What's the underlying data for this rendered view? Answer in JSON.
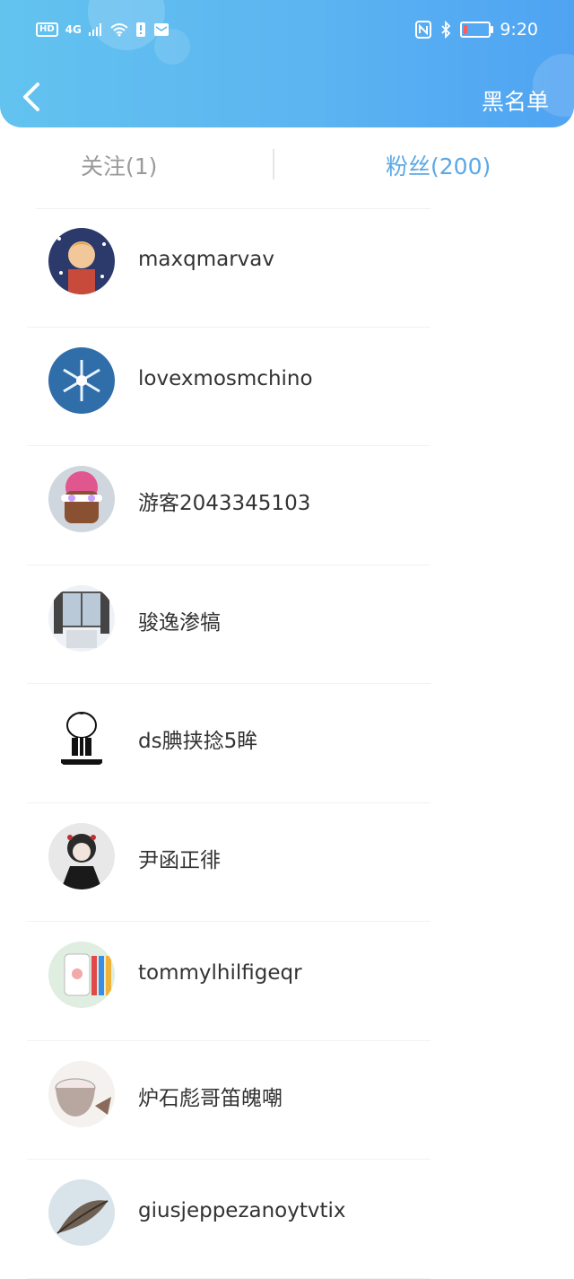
{
  "status_bar": {
    "left_badge": "HD",
    "network": "4G",
    "time": "9:20"
  },
  "header": {
    "back_icon": "chevron-left-icon",
    "action_label": "黑名单"
  },
  "tabs": {
    "following": "关注(1)",
    "fans": "粉丝(200)"
  },
  "fans": [
    {
      "name": "maxqmarvav",
      "avatar": "anime-character-stars"
    },
    {
      "name": "lovexmosmchino",
      "avatar": "snowflake"
    },
    {
      "name": "游客2043345103",
      "avatar": "pink-hair-sunglasses"
    },
    {
      "name": "骏逸渗犒",
      "avatar": "winter-window"
    },
    {
      "name": "ds腆挟捻5眸",
      "avatar": "meme-cartoon"
    },
    {
      "name": "尹函正徘",
      "avatar": "dark-anime-character"
    },
    {
      "name": "tommylhilfigeqr",
      "avatar": "phone-case"
    },
    {
      "name": "炉石彪哥笛魄嘲",
      "avatar": "cream-bowl"
    },
    {
      "name": "giusjeppezanoytvtix",
      "avatar": "leaf-art"
    }
  ],
  "colors": {
    "header_start": "#63c3ef",
    "header_end": "#4fa3f2",
    "tab_active": "#5aa8e6",
    "tab_inactive": "#9a9a9a",
    "text": "#333333"
  }
}
